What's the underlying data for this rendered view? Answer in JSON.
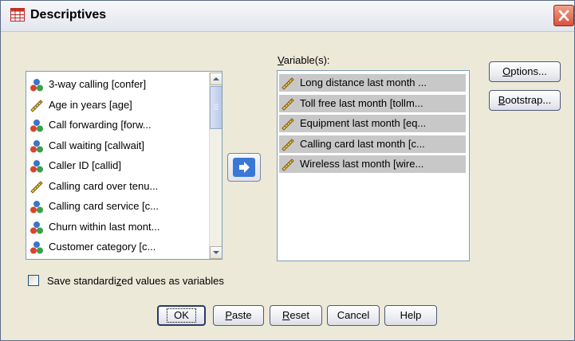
{
  "window": {
    "title": "Descriptives"
  },
  "source_list": {
    "items": [
      {
        "label": "3-way calling [confer]",
        "icon": "nominal-icon"
      },
      {
        "label": "Age in years [age]",
        "icon": "scale-icon"
      },
      {
        "label": "Call forwarding [forw...",
        "icon": "nominal-icon"
      },
      {
        "label": "Call waiting [callwait]",
        "icon": "nominal-icon"
      },
      {
        "label": "Caller ID [callid]",
        "icon": "nominal-icon"
      },
      {
        "label": "Calling card over tenu...",
        "icon": "scale-icon"
      },
      {
        "label": "Calling card service [c...",
        "icon": "nominal-icon"
      },
      {
        "label": "Churn within last mont...",
        "icon": "nominal-icon"
      },
      {
        "label": "Customer category [c...",
        "icon": "nominal-icon"
      }
    ]
  },
  "variables": {
    "label_prefix": "",
    "label_mnemonic": "V",
    "label_rest": "ariable(s):",
    "items": [
      {
        "label": "Long distance last month ...",
        "icon": "scale-icon"
      },
      {
        "label": "Toll free last month [tollm...",
        "icon": "scale-icon"
      },
      {
        "label": "Equipment last month [eq...",
        "icon": "scale-icon"
      },
      {
        "label": "Calling card last month [c...",
        "icon": "scale-icon"
      },
      {
        "label": "Wireless last month [wire...",
        "icon": "scale-icon"
      }
    ]
  },
  "side_buttons": {
    "options": {
      "mn": "O",
      "rest": "ptions..."
    },
    "bootstrap": {
      "mn": "B",
      "rest": "ootstrap..."
    }
  },
  "checkbox": {
    "checked": false,
    "pre": "Save standardi",
    "mn": "z",
    "post": "ed values as variables"
  },
  "buttons": {
    "ok": "OK",
    "paste": {
      "mn": "P",
      "rest": "aste"
    },
    "reset": {
      "mn": "R",
      "rest": "eset"
    },
    "cancel": "Cancel",
    "help": "Help"
  },
  "colors": {
    "selection": "#c8c8c8",
    "dialog_bg": "#ece9d8",
    "list_border": "#7f9db9"
  }
}
